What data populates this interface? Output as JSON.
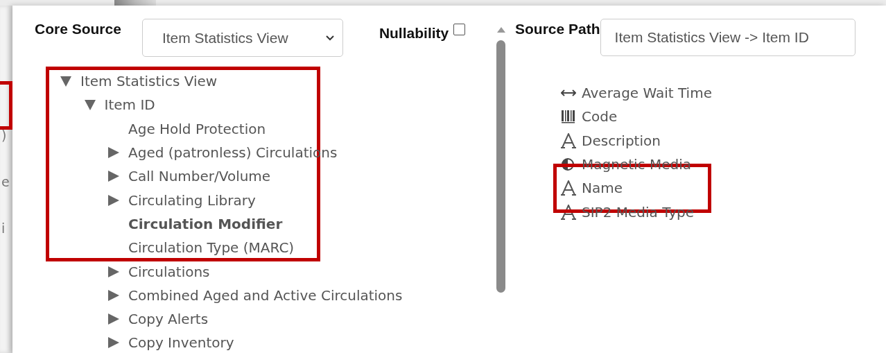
{
  "background_fragments": [
    {
      "text": ")"
    },
    {
      "text": "e"
    },
    {
      "text": "i"
    }
  ],
  "core_source": {
    "label": "Core Source",
    "value": "Item Statistics View"
  },
  "nullability": {
    "label": "Nullability",
    "checked": false
  },
  "source_path": {
    "label": "Source Path",
    "value": "Item Statistics View -> Item ID"
  },
  "tree": [
    {
      "label": "Item Statistics View",
      "expanded": true,
      "selected": false,
      "children": [
        {
          "label": "Item ID",
          "expanded": true,
          "selected": false,
          "children": [
            {
              "label": "Age Hold Protection",
              "selected": false
            },
            {
              "label": "Aged (patronless) Circulations",
              "expanded": false,
              "selected": false
            },
            {
              "label": "Call Number/Volume",
              "expanded": false,
              "selected": false
            },
            {
              "label": "Circulating Library",
              "expanded": false,
              "selected": false
            },
            {
              "label": "Circulation Modifier",
              "selected": true
            },
            {
              "label": "Circulation Type (MARC)",
              "selected": false
            },
            {
              "label": "Circulations",
              "expanded": false,
              "selected": false
            },
            {
              "label": "Combined Aged and Active Circulations",
              "expanded": false,
              "selected": false
            },
            {
              "label": "Copy Alerts",
              "expanded": false,
              "selected": false
            },
            {
              "label": "Copy Inventory",
              "expanded": false,
              "selected": false
            }
          ]
        }
      ]
    }
  ],
  "fields": [
    {
      "label": "Average Wait Time",
      "kind": "interval"
    },
    {
      "label": "Code",
      "kind": "id"
    },
    {
      "label": "Description",
      "kind": "text"
    },
    {
      "label": "Magnetic Media",
      "kind": "bool"
    },
    {
      "label": "Name",
      "kind": "text"
    },
    {
      "label": "SIP2 Media Type",
      "kind": "text"
    }
  ]
}
